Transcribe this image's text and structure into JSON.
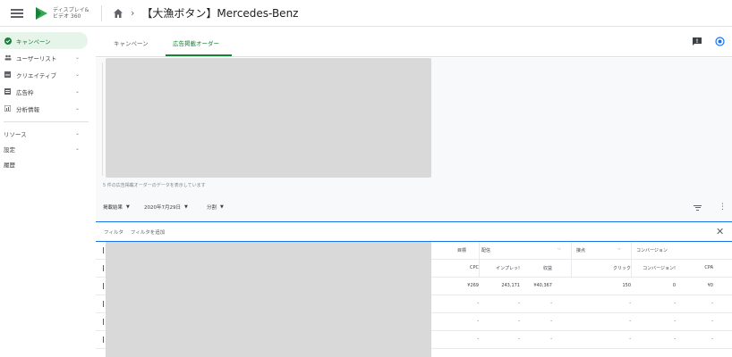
{
  "header": {
    "brand_line1": "ディスプレイ&",
    "brand_line2": "ビデオ 360",
    "breadcrumb_sep": "›",
    "title": "【大漁ボタン】Mercedes-Benz"
  },
  "sidebar": {
    "items": [
      {
        "label": "キャンペーン",
        "icon": "check-circle-icon"
      },
      {
        "label": "ユーザーリスト",
        "icon": "users-icon"
      },
      {
        "label": "クリエイティブ",
        "icon": "creative-icon"
      },
      {
        "label": "広告枠",
        "icon": "inventory-icon"
      },
      {
        "label": "分析情報",
        "icon": "insights-icon"
      }
    ],
    "section2": [
      {
        "label": "リソース"
      },
      {
        "label": "設定"
      },
      {
        "label": "履歴"
      }
    ],
    "chevron": "⌄"
  },
  "tabs": {
    "campaign": "キャンペーン",
    "io": "広告掲載オーダー"
  },
  "content": {
    "count_text": "5 件の広告掲載オーダーのデータを表示しています",
    "metric_select": "掲載結果",
    "date_select": "2020年7月29日",
    "segment_select": "分割"
  },
  "filter": {
    "label": "フィルタ",
    "add": "フィルタを追加",
    "close": "✕"
  },
  "table": {
    "group_headers": [
      "目標",
      "配信",
      "接点",
      "コンバージョン"
    ],
    "arrows": "‹›",
    "col_headers": [
      "CPC",
      "インプレッ!",
      "収益",
      "クリック",
      "コンバージョン!",
      "CPA"
    ],
    "rows": [
      [
        "¥269",
        "243,171",
        "¥40,367",
        "150",
        "0",
        "¥0"
      ],
      [
        "-",
        "-",
        "-",
        "-",
        "-",
        "-"
      ],
      [
        "-",
        "-",
        "-",
        "-",
        "-",
        "-"
      ],
      [
        "-",
        "-",
        "-",
        "-",
        "-",
        "-"
      ]
    ]
  },
  "colors": {
    "accent": "#188038",
    "active_bg": "#e6f4ea",
    "filter_border": "#1a73e8"
  }
}
